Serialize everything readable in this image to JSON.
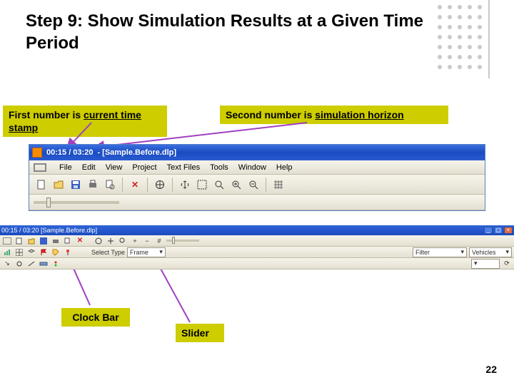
{
  "page_number": "22",
  "title": "Step 9: Show Simulation Results at a Given Time Period",
  "callouts": {
    "first_label_pre": "First  number is ",
    "first_label_u1": "current  time",
    "first_label_u2": "stamp",
    "second_label_pre": "Second number is  ",
    "second_label_u": "simulation horizon",
    "clock_bar": "Clock Bar",
    "slider": "Slider"
  },
  "app": {
    "title_time": "00:15 / 03:20",
    "title_doc": "- [Sample.Before.dlp]",
    "menu": [
      "File",
      "Edit",
      "View",
      "Project",
      "Text Files",
      "Tools",
      "Window",
      "Help"
    ]
  },
  "mini": {
    "title": "00:15 / 03:20  [Sample.Before.dlp]",
    "select_label": "Select Type",
    "select_value": "Frame",
    "filter_label": "Filter",
    "vehicles_label": "Vehicles"
  }
}
